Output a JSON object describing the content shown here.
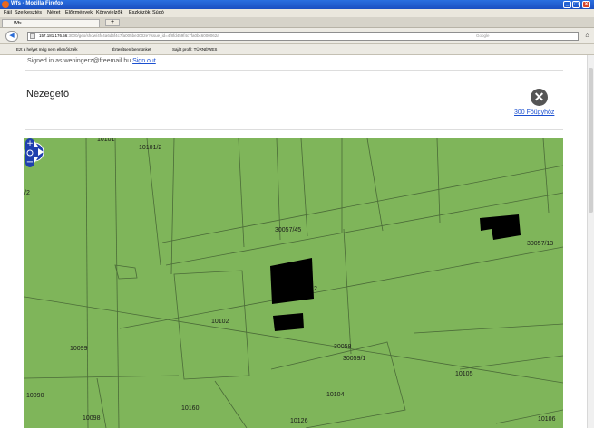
{
  "browser": {
    "window_title": "Wfs - Mozilla Firefox",
    "menu": [
      "Fájl",
      "Szerkesztés",
      "Nézet",
      "Előzmények",
      "Könyvjelzők",
      "Eszközök",
      "Súgó"
    ],
    "tab_title": "Wfs",
    "new_tab": "+",
    "url_host": "157.181.176.56",
    "url_rest": ":3000/geo/show/4fc4a6d5f4c7fa005be3002e?issue_id=4f8fd459f4c7fa0bc6000062a",
    "search_placeholder": "Google",
    "bookmarks": [
      "Ezt a helyet még nem ellenőrizték",
      "Értesítsen bennünket",
      "Saját profil: TÜRNÉWES"
    ]
  },
  "page": {
    "signed_prefix": "Signed in as weningerz@freemail.hu",
    "sign_out": "Sign out",
    "title": "Nézegető",
    "close_symbol": "✕",
    "footway_link": "300 Főügyhöz"
  },
  "map": {
    "labels": [
      {
        "id": "parcel-10101-2-label",
        "text": "10101/2"
      },
      {
        "id": "parcel-10101-label-partial",
        "text": "10101"
      },
      {
        "id": "parcel-30057-45-label",
        "text": "30057/45"
      },
      {
        "id": "parcel-30057-13-label",
        "text": "30057/13"
      },
      {
        "id": "parcel-2-label",
        "text": "2"
      },
      {
        "id": "parcel-10102-label",
        "text": "10102"
      },
      {
        "id": "parcel-10099-label",
        "text": "10099"
      },
      {
        "id": "parcel-30058-label",
        "text": "30058"
      },
      {
        "id": "parcel-30059-1-label",
        "text": "30059/1"
      },
      {
        "id": "parcel-10105-label",
        "text": "10105"
      },
      {
        "id": "parcel-10090-label",
        "text": "10090"
      },
      {
        "id": "parcel-10104-label",
        "text": "10104"
      },
      {
        "id": "parcel-10160-label",
        "text": "10160"
      },
      {
        "id": "parcel-10098-label",
        "text": "10098"
      },
      {
        "id": "parcel-10126-label",
        "text": "10126"
      },
      {
        "id": "parcel-10106-label",
        "text": "10106"
      },
      {
        "id": "parcel-2-left-label",
        "text": "/2"
      }
    ],
    "colors": {
      "land": "#7fb55a",
      "building": "#000000",
      "line": "#4b6b38"
    }
  }
}
